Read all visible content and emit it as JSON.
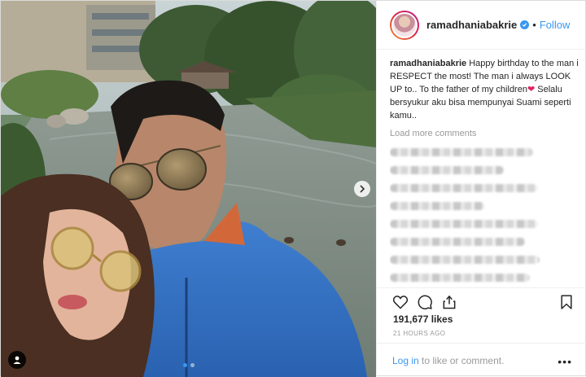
{
  "post": {
    "carousel": {
      "count": 2,
      "active_index": 0
    },
    "icons": {
      "next": "chevron-right-icon",
      "user_tag": "user-tag-icon",
      "verified": "verified-badge-icon",
      "like": "heart-outline-icon",
      "comment": "comment-bubble-icon",
      "share": "share-icon",
      "save": "bookmark-icon",
      "more": "more-options-icon"
    }
  },
  "header": {
    "username": "ramadhaniabakrie",
    "separator": "•",
    "follow_label": "Follow"
  },
  "caption": {
    "username": "ramadhaniabakrie",
    "text_before_emoji": "Happy birthday to the man i RESPECT the most! The man i always LOOK UP to.. To the father of my children",
    "emoji": "❤",
    "text_after_emoji": " Selalu bersyukur aku bisa mempunyai Suami seperti kamu.."
  },
  "comments": {
    "load_more_label": "Load more comments"
  },
  "stats": {
    "likes": "191,677 likes",
    "time_ago": "21 HOURS AGO"
  },
  "footer": {
    "login_link": "Log in",
    "login_suffix": " to like or comment.",
    "more_label": "•••"
  },
  "colors": {
    "accent": "#3897f0",
    "heart": "#e0245e",
    "muted": "#999999",
    "border": "#efefef"
  }
}
